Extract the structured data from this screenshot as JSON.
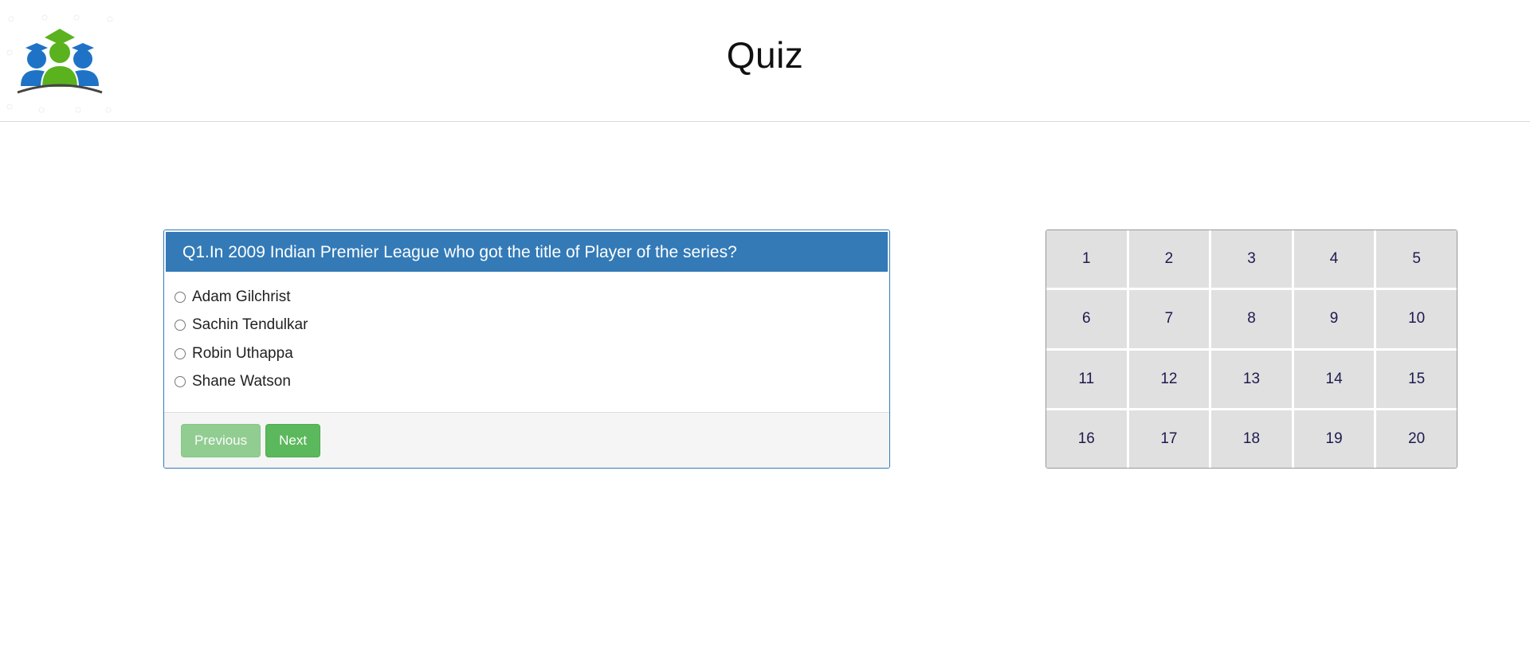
{
  "header": {
    "title": "Quiz"
  },
  "question": {
    "text": "Q1.In 2009 Indian Premier League who got the title of Player of the series?",
    "options": [
      {
        "label": "Adam Gilchrist"
      },
      {
        "label": "Sachin Tendulkar"
      },
      {
        "label": "Robin Uthappa"
      },
      {
        "label": "Shane Watson"
      }
    ],
    "previous_label": "Previous",
    "next_label": "Next"
  },
  "navigation": {
    "numbers": [
      "1",
      "2",
      "3",
      "4",
      "5",
      "6",
      "7",
      "8",
      "9",
      "10",
      "11",
      "12",
      "13",
      "14",
      "15",
      "16",
      "17",
      "18",
      "19",
      "20"
    ]
  },
  "colors": {
    "primary": "#337ab7",
    "success": "#5cb85c",
    "grid_cell": "#e0e0e0"
  }
}
